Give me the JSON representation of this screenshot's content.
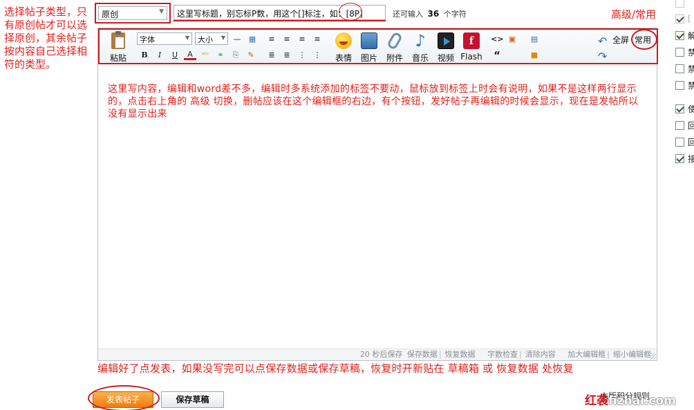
{
  "annotations": {
    "left": "选择帖子类型，只有原创帖才可以选择原创，其余帖子按内容自己选择相符的类型。",
    "top_right": "高级/常用",
    "bottom": "编辑好了点发表，如果没写完可以点保存数据或保存草稿，恢复时开新贴在 草稿箱 或 恢复数据 处恢复"
  },
  "thread_type": {
    "selected": "原创"
  },
  "title": {
    "value": "这里写标题，别忘标P数，用这个[]标注，如：[8P]",
    "remaining_prefix": "还可输入",
    "remaining_count": "36",
    "remaining_suffix": "个字符"
  },
  "toolbar": {
    "paste_label": "粘贴",
    "font_placeholder": "字体",
    "size_placeholder": "大小",
    "row1_glyphs": [
      "—",
      "▦",
      "≡",
      "≡",
      "≡",
      "≡"
    ],
    "row2_glyphs": [
      "B",
      "I",
      "U",
      "A",
      "ᵃᵇᶜ",
      "⚭",
      "⎘",
      "✎",
      "≣",
      "≣",
      "⋮",
      "⋮"
    ],
    "emoticon_label": "表情",
    "image_label": "图片",
    "attachment_label": "附件",
    "music_label": "音乐",
    "video_label": "视频",
    "flash_label": "Flash",
    "flash_icon_letter": "f",
    "code_glyph": "<>",
    "quote_glyph": "“",
    "fullscreen_label": "全屏",
    "mode_label": "常用"
  },
  "editor": {
    "content": "这里写内容，编辑和word差不多，编辑时多系统添加的标签不要动，鼠标放到标签上时会有说明，如果不是这样两行显示的，点击右上角的 高级 切换，删帖应该在这个编辑框的右边，有个按钮，发好帖子再编辑的时候会显示，现在是发帖所以没有显示出来",
    "status": {
      "autosave": "20 秒后保存",
      "save_data": "保存数据",
      "restore_data": "恢复数据",
      "word_check": "字数检查",
      "clear_content": "清除内容",
      "enlarge": "加大编辑框",
      "shrink": "缩小编辑框"
    }
  },
  "right_options": [
    {
      "checked": false,
      "disabled": true,
      "label": ""
    },
    {
      "checked": true,
      "disabled": true,
      "label": "["
    },
    {
      "checked": true,
      "disabled": false,
      "label": "解"
    },
    {
      "checked": false,
      "disabled": false,
      "label": "禁"
    },
    {
      "checked": false,
      "disabled": false,
      "label": "禁"
    },
    {
      "checked": false,
      "disabled": false,
      "label": "禁"
    },
    {
      "checked": true,
      "disabled": false,
      "label": "使"
    },
    {
      "checked": false,
      "disabled": false,
      "label": "回"
    },
    {
      "checked": false,
      "disabled": false,
      "label": "回"
    },
    {
      "checked": true,
      "disabled": false,
      "label": "接"
    }
  ],
  "buttons": {
    "submit": "发表帖子",
    "save_draft": "保存草稿",
    "points_rules": "本版积分规则"
  },
  "watermark": {
    "part1": "红袭",
    "part2": "fizhai.com"
  }
}
